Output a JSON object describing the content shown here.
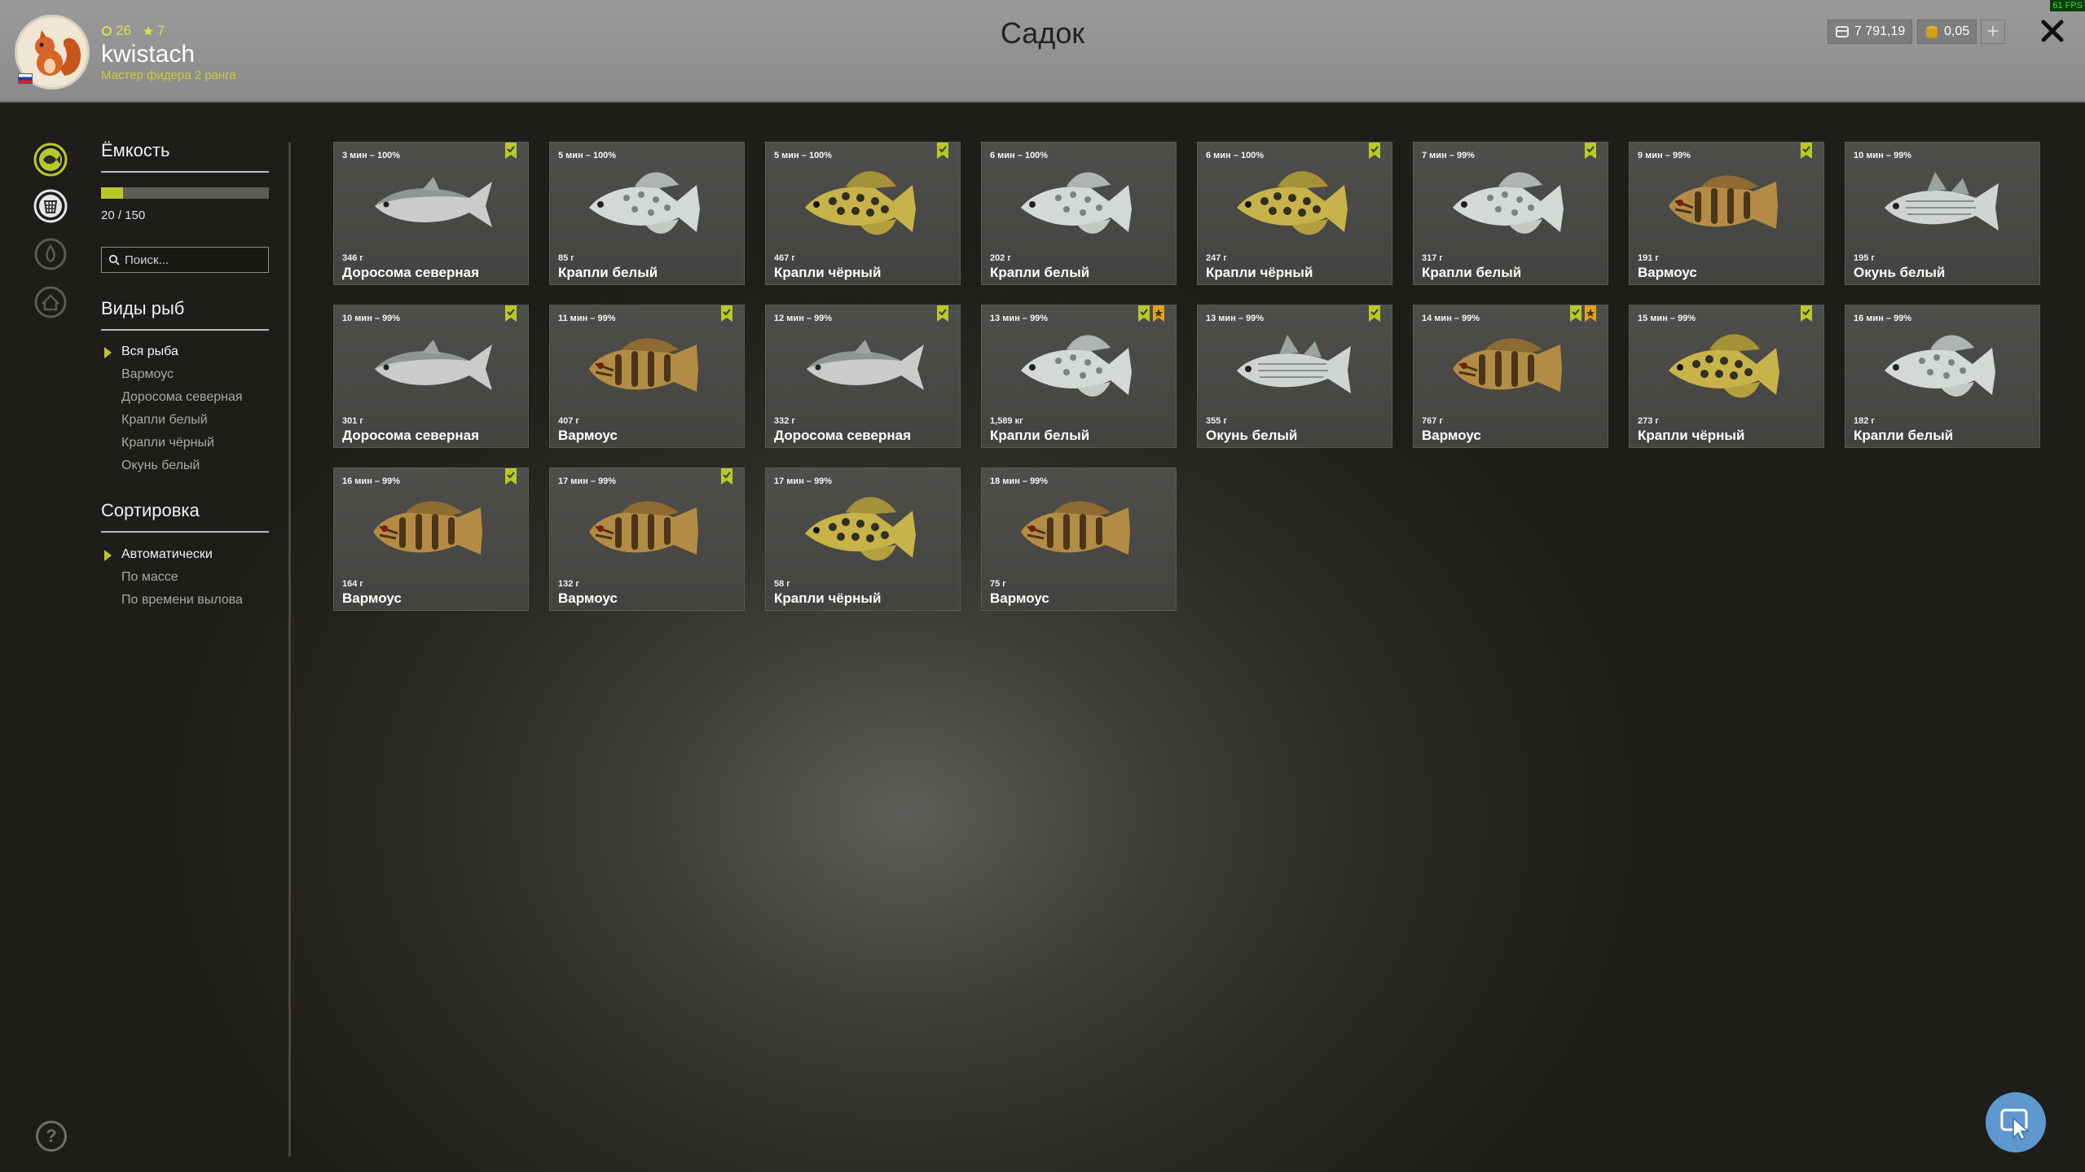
{
  "header": {
    "title": "Садок",
    "user": {
      "name": "kwistach",
      "level": "26",
      "stars": "7",
      "rank": "Мастер фидера 2 ранга"
    },
    "silver": "7 791,19",
    "gold": "0,05",
    "plus_label": "+",
    "fps": "61 FPS"
  },
  "sidebar": {
    "capacity_title": "Ёмкость",
    "capacity_text": "20 / 150",
    "capacity_fraction": 0.133,
    "search_placeholder": "Поиск...",
    "species_title": "Виды рыб",
    "species": [
      "Вся рыба",
      "Вармоус",
      "Доросома северная",
      "Крапли белый",
      "Крапли чёрный",
      "Окунь белый"
    ],
    "sort_title": "Сортировка",
    "sort": [
      "Автоматически",
      "По массе",
      "По времени вылова"
    ]
  },
  "colors": {
    "accent": "#b8c92e",
    "gold_badge": "#e0a418"
  },
  "fish": [
    {
      "time": "3 мин – 100%",
      "weight": "346 г",
      "name": "Доросома северная",
      "kind": "shad",
      "badges": [
        "green"
      ]
    },
    {
      "time": "5 мин – 100%",
      "weight": "85 г",
      "name": "Крапли белый",
      "kind": "wcrappie",
      "badges": []
    },
    {
      "time": "5 мин – 100%",
      "weight": "467 г",
      "name": "Крапли чёрный",
      "kind": "bcrappie",
      "badges": [
        "green"
      ]
    },
    {
      "time": "6 мин – 100%",
      "weight": "202 г",
      "name": "Крапли белый",
      "kind": "wcrappie",
      "badges": []
    },
    {
      "time": "6 мин – 100%",
      "weight": "247 г",
      "name": "Крапли чёрный",
      "kind": "bcrappie",
      "badges": [
        "green"
      ]
    },
    {
      "time": "7 мин – 99%",
      "weight": "317 г",
      "name": "Крапли белый",
      "kind": "wcrappie",
      "badges": [
        "green"
      ]
    },
    {
      "time": "9 мин – 99%",
      "weight": "191 г",
      "name": "Вармоус",
      "kind": "warmouth",
      "badges": [
        "green"
      ]
    },
    {
      "time": "10 мин – 99%",
      "weight": "195 г",
      "name": "Окунь белый",
      "kind": "wbass",
      "badges": []
    },
    {
      "time": "10 мин – 99%",
      "weight": "301 г",
      "name": "Доросома северная",
      "kind": "shad",
      "badges": [
        "green"
      ]
    },
    {
      "time": "11 мин – 99%",
      "weight": "407 г",
      "name": "Вармоус",
      "kind": "warmouth",
      "badges": [
        "green"
      ]
    },
    {
      "time": "12 мин – 99%",
      "weight": "332 г",
      "name": "Доросома северная",
      "kind": "shad",
      "badges": [
        "green"
      ]
    },
    {
      "time": "13 мин – 99%",
      "weight": "1,589 кг",
      "name": "Крапли белый",
      "kind": "wcrappie",
      "badges": [
        "green",
        "gold"
      ]
    },
    {
      "time": "13 мин – 99%",
      "weight": "355 г",
      "name": "Окунь белый",
      "kind": "wbass",
      "badges": [
        "green"
      ]
    },
    {
      "time": "14 мин – 99%",
      "weight": "767 г",
      "name": "Вармоус",
      "kind": "warmouth",
      "badges": [
        "green",
        "gold"
      ]
    },
    {
      "time": "15 мин – 99%",
      "weight": "273 г",
      "name": "Крапли чёрный",
      "kind": "bcrappie",
      "badges": [
        "green"
      ]
    },
    {
      "time": "16 мин – 99%",
      "weight": "182 г",
      "name": "Крапли белый",
      "kind": "wcrappie",
      "badges": []
    },
    {
      "time": "16 мин – 99%",
      "weight": "164 г",
      "name": "Вармоус",
      "kind": "warmouth",
      "badges": [
        "green"
      ]
    },
    {
      "time": "17 мин – 99%",
      "weight": "132 г",
      "name": "Вармоус",
      "kind": "warmouth",
      "badges": [
        "green"
      ]
    },
    {
      "time": "17 мин – 99%",
      "weight": "58 г",
      "name": "Крапли чёрный",
      "kind": "bcrappie",
      "badges": []
    },
    {
      "time": "18 мин – 99%",
      "weight": "75 г",
      "name": "Вармоус",
      "kind": "warmouth",
      "badges": []
    }
  ]
}
